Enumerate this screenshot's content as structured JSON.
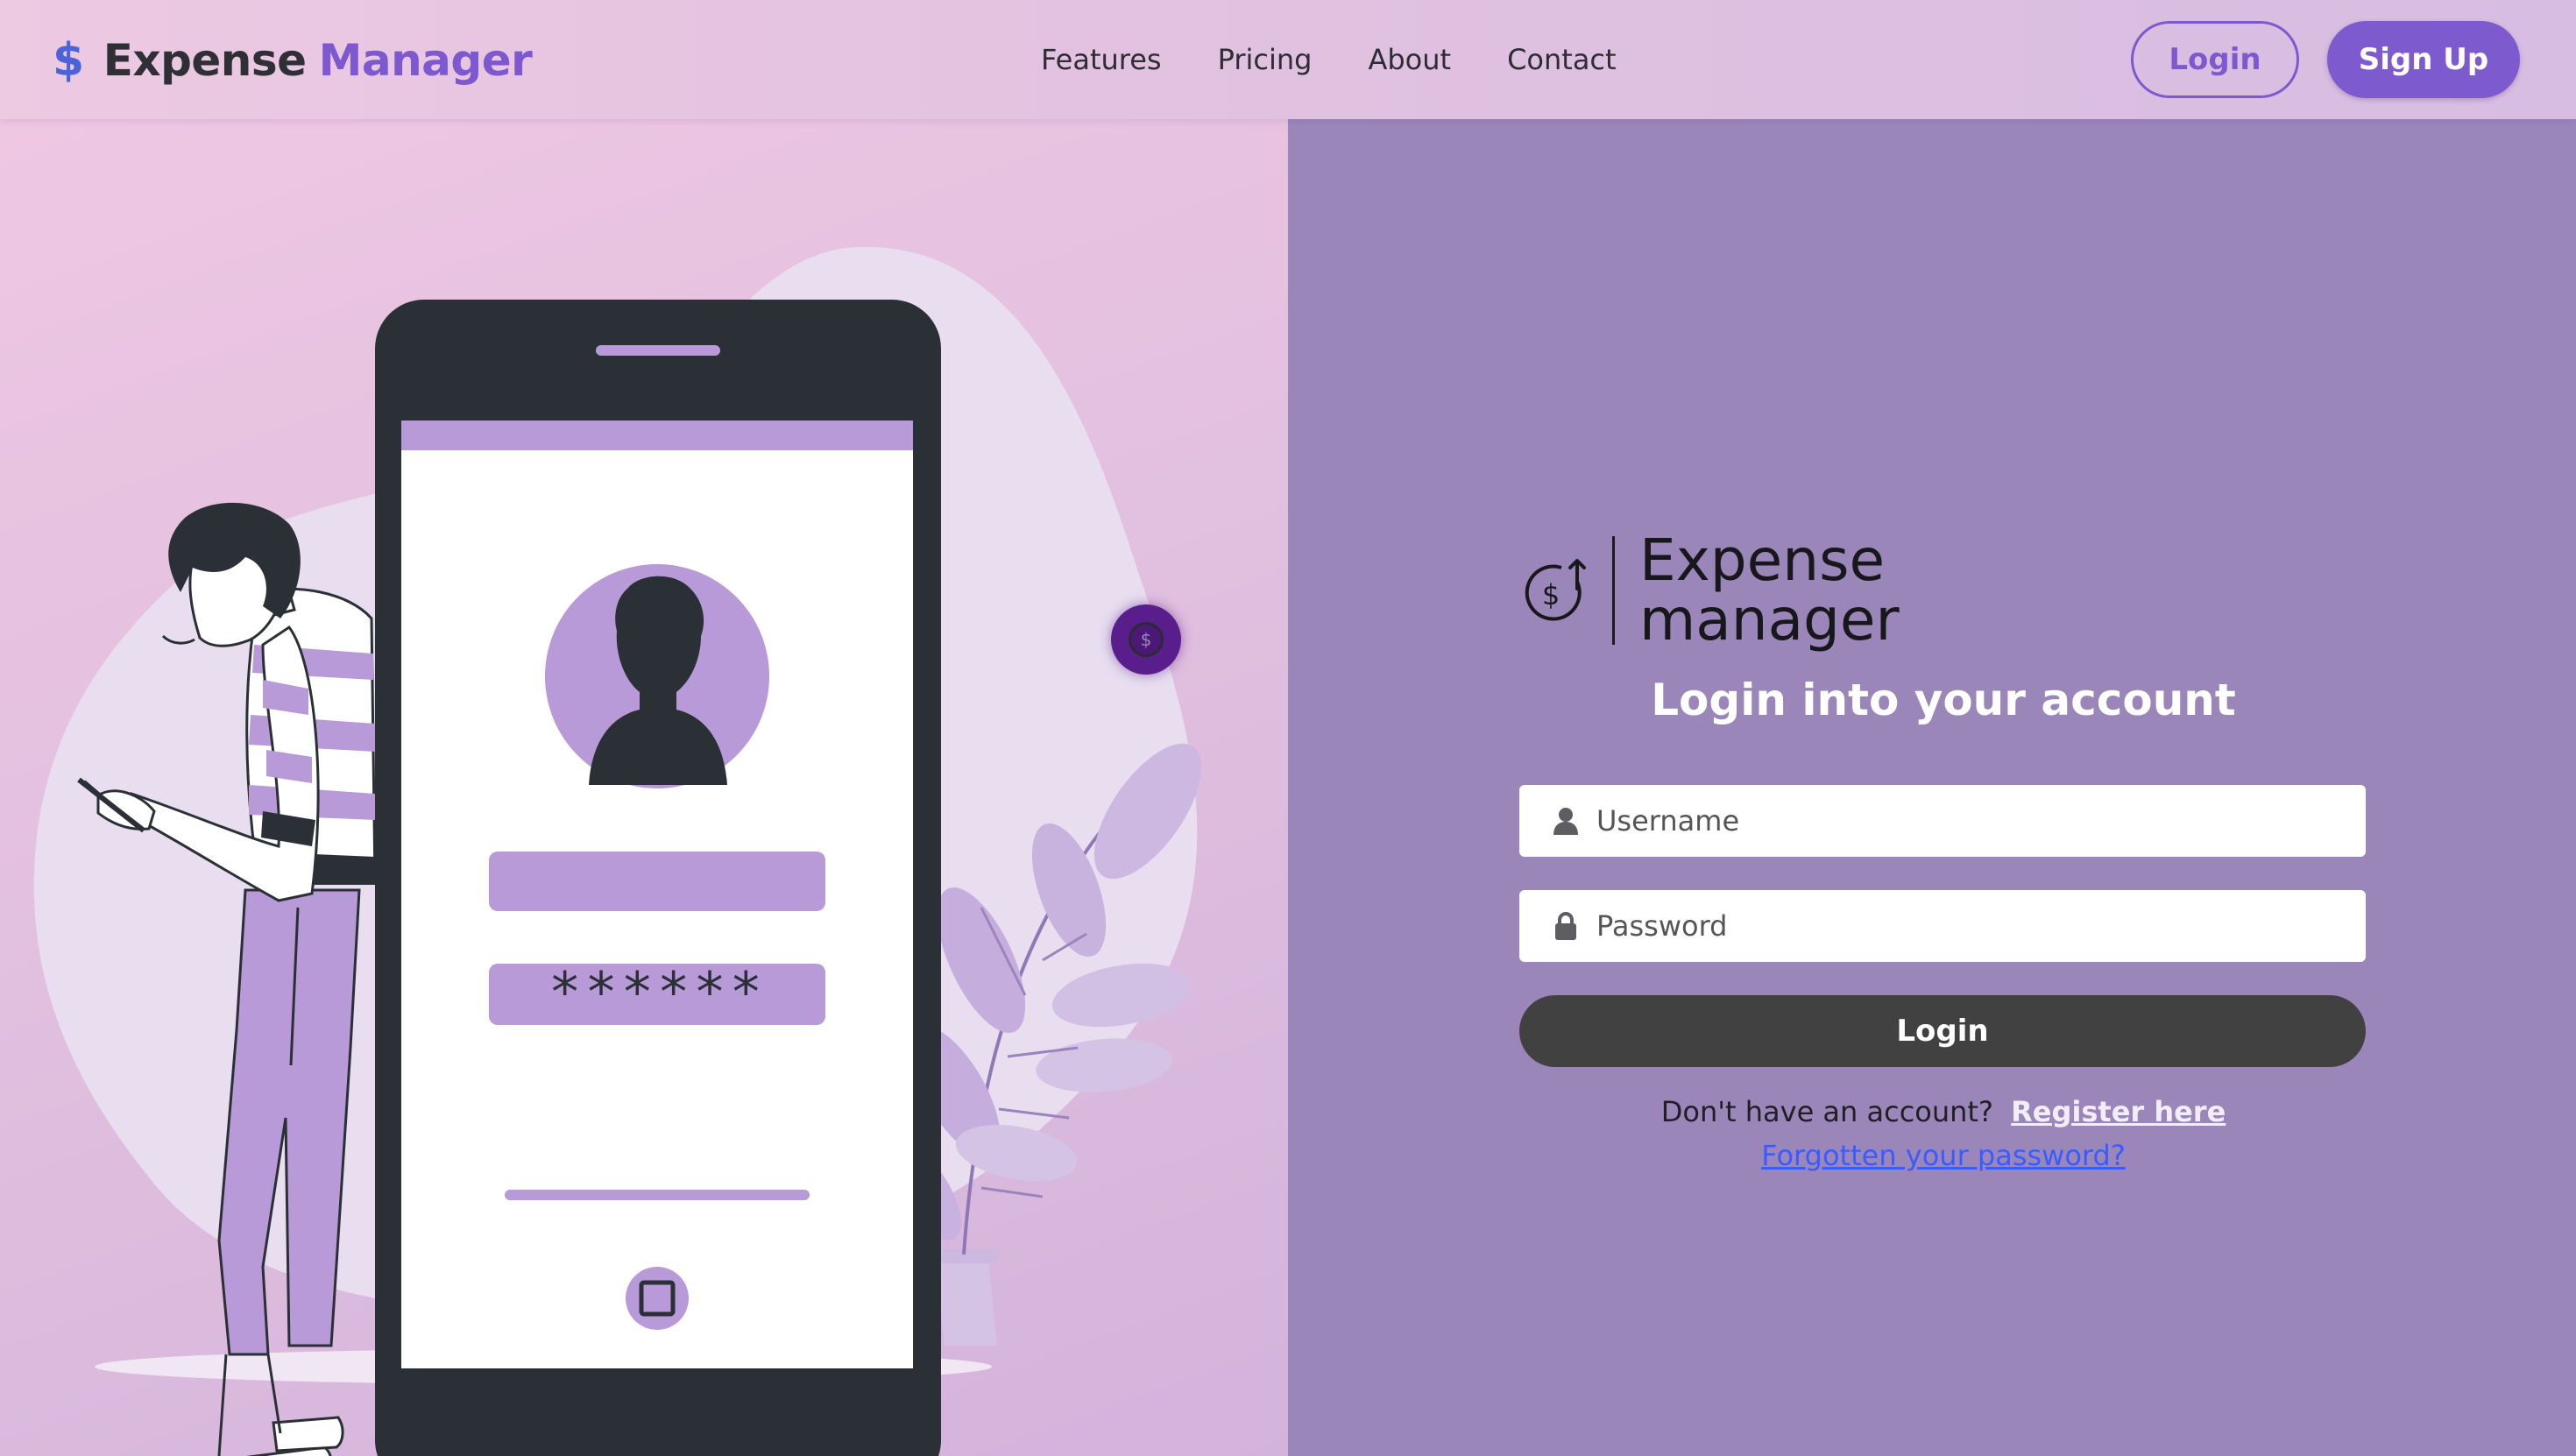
{
  "navbar": {
    "brand": {
      "symbol": "$",
      "word1": "Expense",
      "word2": "Manager"
    },
    "links": [
      "Features",
      "Pricing",
      "About",
      "Contact"
    ],
    "login_label": "Login",
    "signup_label": "Sign Up"
  },
  "illustration": {
    "password_mask": "******"
  },
  "floating_badge": {
    "symbol": "$"
  },
  "login_form": {
    "logo_line1": "Expense",
    "logo_line2": "manager",
    "heading": "Login into your account",
    "username_placeholder": "Username",
    "username_value": "",
    "password_placeholder": "Password",
    "password_value": "",
    "login_button": "Login",
    "register_prompt": "Don't have an account?",
    "register_link": "Register here",
    "forgot_link": "Forgotten your password?"
  },
  "colors": {
    "brand_purple": "#7d59cf",
    "brand_blue": "#4c63d8",
    "panel_purple": "#9b86ba",
    "button_dark": "#414141",
    "link_blue": "#3a5cff"
  },
  "icons": [
    "dollar-icon",
    "user-icon",
    "lock-icon",
    "money-up-icon",
    "avatar-icon",
    "home-button-icon"
  ]
}
